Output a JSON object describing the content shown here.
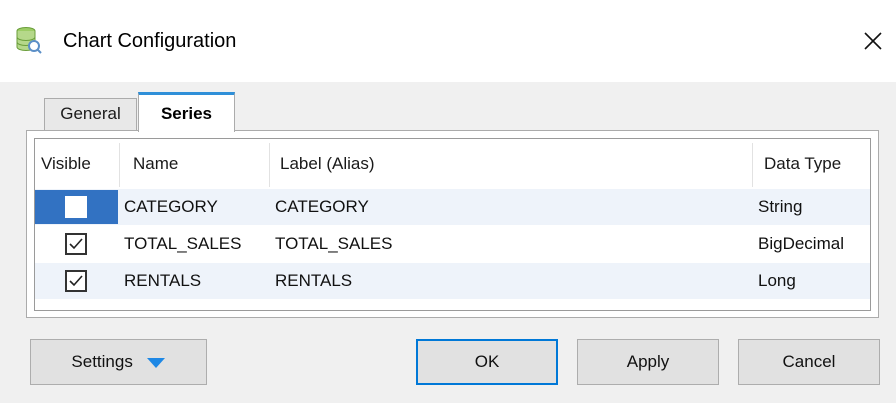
{
  "window": {
    "title": "Chart Configuration"
  },
  "tabs": [
    {
      "label": "General"
    },
    {
      "label": "Series"
    }
  ],
  "table": {
    "columns": [
      "Visible",
      "Name",
      "Label (Alias)",
      "Data Type"
    ],
    "rows": [
      {
        "visible": false,
        "name": "CATEGORY",
        "label": "CATEGORY",
        "type": "String"
      },
      {
        "visible": true,
        "name": "TOTAL_SALES",
        "label": "TOTAL_SALES",
        "type": "BigDecimal"
      },
      {
        "visible": true,
        "name": "RENTALS",
        "label": "RENTALS",
        "type": "Long"
      }
    ]
  },
  "buttons": {
    "settings": "Settings",
    "ok": "OK",
    "apply": "Apply",
    "cancel": "Cancel"
  },
  "colors": {
    "accent": "#2f8fd8",
    "selection": "#3272c2",
    "caret": "#1e88e5"
  }
}
